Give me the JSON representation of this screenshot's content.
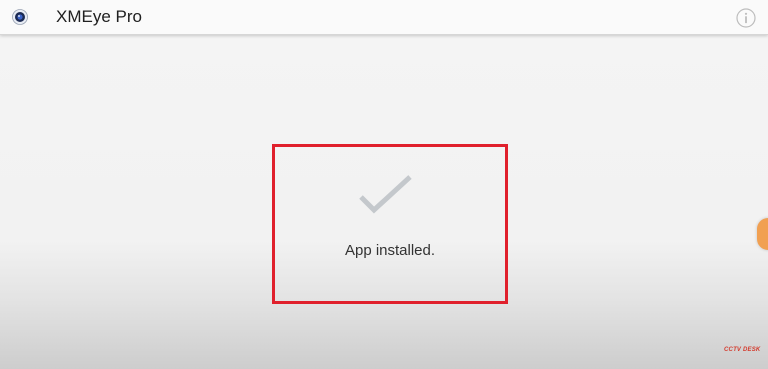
{
  "app_bar": {
    "title": "XMEye Pro",
    "app_icon": "xmeye-lens-icon",
    "info_icon": "info-icon"
  },
  "status": {
    "message": "App installed.",
    "icon": "checkmark-icon"
  },
  "watermark": {
    "text": "CCTV DESK"
  },
  "colors": {
    "highlight_border": "#e0202c",
    "checkmark": "#c4c8cc",
    "title_text": "#202020"
  }
}
